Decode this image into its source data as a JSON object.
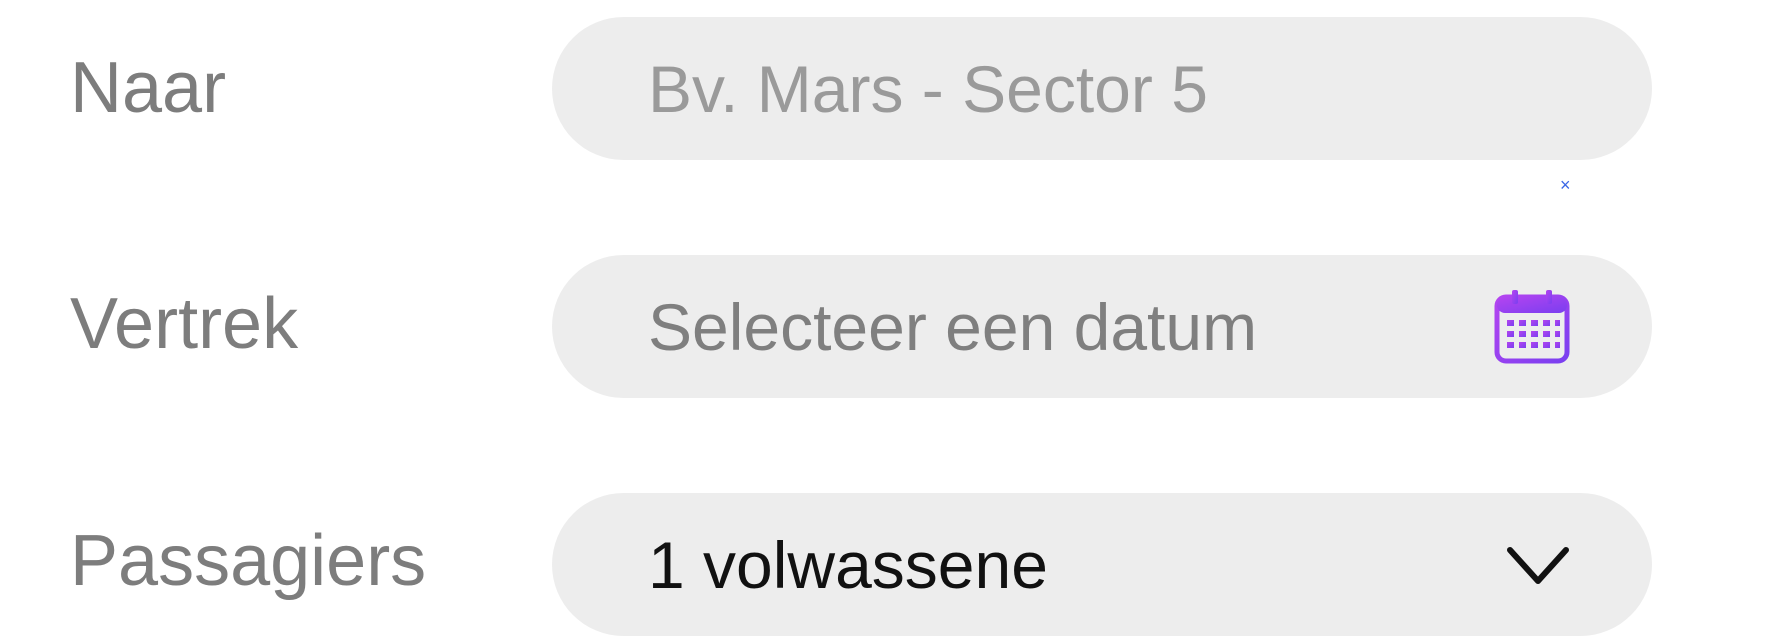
{
  "colors": {
    "label": "#7d7d7d",
    "field_background": "#ededed",
    "placeholder": "#9a9a9a",
    "value": "#111111",
    "accent_purple": "#a93ff0",
    "accent_violet": "#7b3ff2",
    "clear_blue": "#3a66e6"
  },
  "destination": {
    "label": "Naar",
    "placeholder": "Bv. Mars - Sector 5",
    "clear_icon": "close-icon",
    "add_icon": "plus-icon",
    "clear_glyph": "×"
  },
  "departure": {
    "label": "Vertrek",
    "placeholder": "Selecteer een datum",
    "icon": "calendar-icon"
  },
  "passengers": {
    "label": "Passagiers",
    "selected": "1 volwassene",
    "icon": "chevron-down-icon"
  }
}
